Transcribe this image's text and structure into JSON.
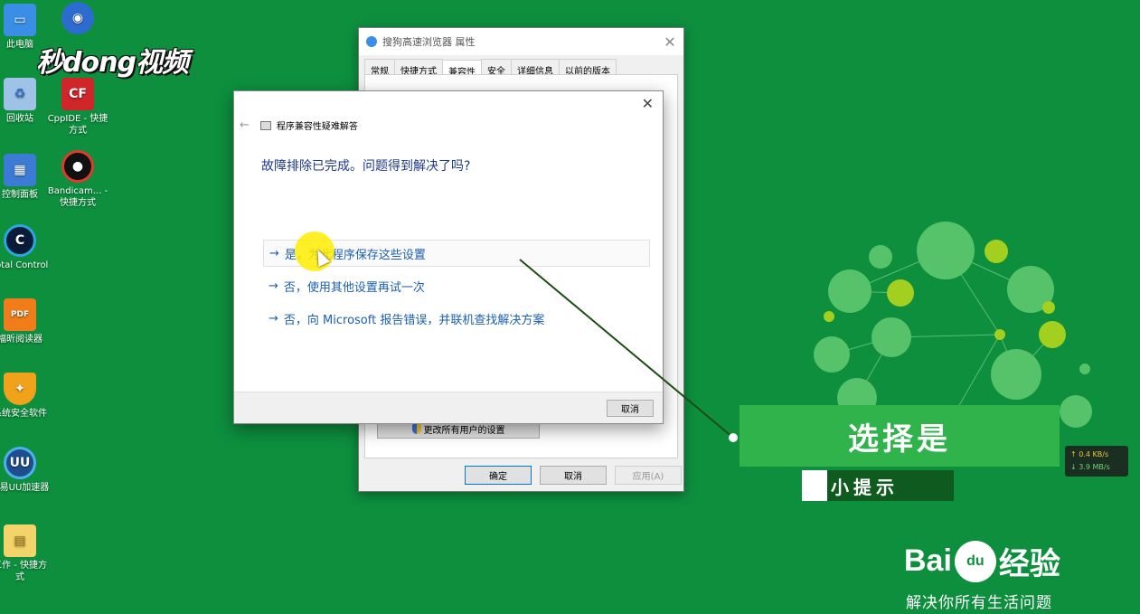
{
  "brand": {
    "text": "秒dong视频"
  },
  "desktop": {
    "icons": [
      {
        "label": "此电脑",
        "icon": "computer-icon",
        "color": "#3a8ee6"
      },
      {
        "label": "回收站",
        "icon": "recycle-bin-icon",
        "color": "#9fc3e6"
      },
      {
        "label": "控制面板",
        "icon": "control-panel-icon",
        "color": "#3b7bd4"
      },
      {
        "label": "Total Control",
        "icon": "total-control-icon",
        "color": "#0b1b3a"
      },
      {
        "label": "福昕阅读器",
        "icon": "pdf-reader-icon",
        "color": "#f07d1a"
      },
      {
        "label": "系统安全软件",
        "icon": "security-shield-icon",
        "color": "#f0a21a"
      },
      {
        "label": "网易UU加速器",
        "icon": "uu-accelerator-icon",
        "color": "#1f4e8c"
      },
      {
        "label": "工作 - 快捷方式",
        "icon": "folder-icon",
        "color": "#f2d46b"
      },
      {
        "label": "",
        "icon": "yuanfang-icon",
        "color": "#2d6ccf"
      },
      {
        "label": "CppIDE - 快捷方式",
        "icon": "cppide-icon",
        "color": "#d0262a",
        "glyph": "CF"
      },
      {
        "label": "Bandicam... - 快捷方式",
        "icon": "bandicam-icon",
        "color": "#111111"
      }
    ]
  },
  "props_dialog": {
    "title": "搜狗高速浏览器 属性",
    "tabs": [
      "常规",
      "快捷方式",
      "兼容性",
      "安全",
      "详细信息",
      "以前的版本"
    ],
    "active_tab": "兼容性",
    "all_users_button": "更改所有用户的设置",
    "ok": "确定",
    "cancel": "取消",
    "apply": "应用(A)"
  },
  "troubleshooter": {
    "title": "程序兼容性疑难解答",
    "question": "故障排除已完成。问题得到解决了吗?",
    "options": [
      "是，为此程序保存这些设置",
      "否，使用其他设置再试一次",
      "否，向 Microsoft 报告错误，并联机查找解决方案"
    ],
    "cancel": "取消"
  },
  "annotation": {
    "callout": "选择是",
    "tip": "小提示"
  },
  "net_speed": {
    "up": "0.4 KB/s",
    "down": "3.9 MB/s"
  },
  "watermark": {
    "logo_left": "Bai",
    "logo_paw": "du",
    "logo_right": "经验",
    "slogan": "解决你所有生活问题"
  },
  "colors": {
    "desktop_bg": "#0d8f3e",
    "callout_bg": "#2fb34a",
    "link": "#1a5fb4",
    "cursor_highlight": "#ffec00"
  }
}
